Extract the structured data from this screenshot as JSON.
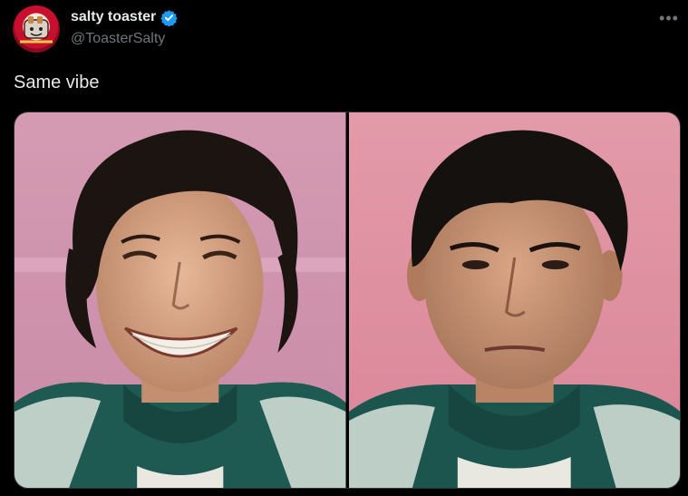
{
  "tweet": {
    "display_name": "salty toaster",
    "handle": "@ToasterSalty",
    "verified": true,
    "more_icon": "more-horizontal-icon",
    "text": "Same vibe",
    "avatar_icon": "toaster-avatar",
    "media": [
      {
        "name": "photo-smiling-man",
        "description_icon": "portrait-smiling"
      },
      {
        "name": "photo-serious-man",
        "description_icon": "portrait-serious"
      }
    ]
  },
  "colors": {
    "background": "#000000",
    "text_primary": "#e7e9ea",
    "text_secondary": "#71767b",
    "verified_blue": "#1d9bf0",
    "pink_backdrop": "#d98aa0",
    "tracksuit_green": "#1f5a52"
  }
}
